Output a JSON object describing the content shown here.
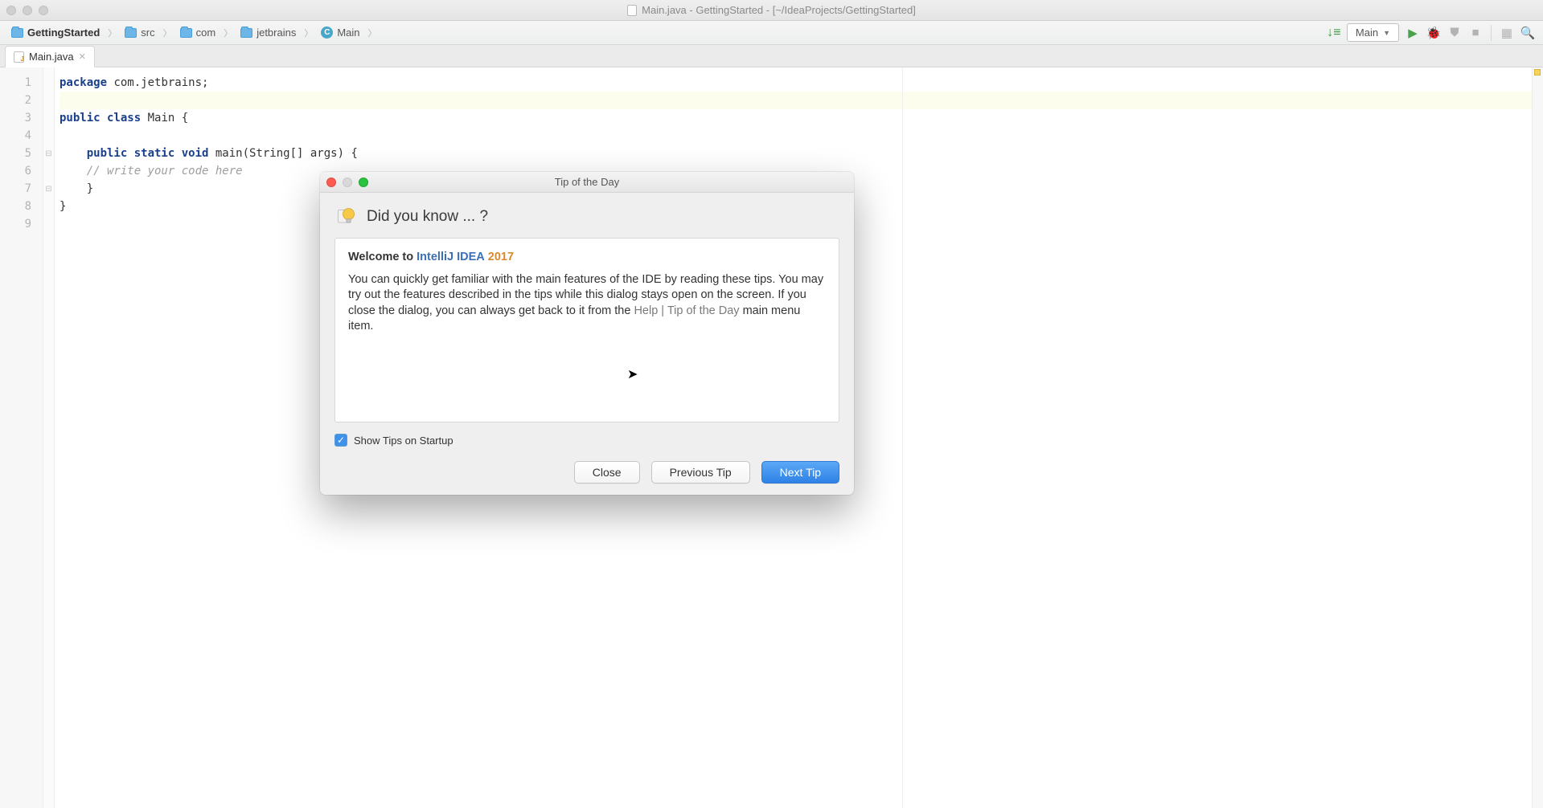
{
  "window": {
    "title": "Main.java - GettingStarted - [~/IdeaProjects/GettingStarted]"
  },
  "breadcrumbs": {
    "project": "GettingStarted",
    "src": "src",
    "com": "com",
    "jetbrains": "jetbrains",
    "klass": "Main"
  },
  "runconfig": {
    "selected": "Main"
  },
  "tab": {
    "name": "Main.java"
  },
  "gutter": {
    "lines": [
      "1",
      "2",
      "3",
      "4",
      "5",
      "6",
      "7",
      "8",
      "9"
    ]
  },
  "code": {
    "l1a": "package",
    "l1b": " com.jetbrains;",
    "l3a": "public class",
    "l3b": " Main {",
    "l5a": "    public static void",
    "l5b": " main(String[] args) {",
    "l6": "    // write your code here",
    "l7": "    }",
    "l8": "}"
  },
  "dialog": {
    "title": "Tip of the Day",
    "heading": "Did you know ... ?",
    "welcome_prefix": "Welcome to ",
    "brand": "IntelliJ IDEA",
    "year": "2017",
    "body1": "You can quickly get familiar with the main features of the IDE by reading these tips. You may try out the features described in the tips while this dialog stays open on the screen. If you close the dialog, you can always get back to it from the ",
    "menu_hint": "Help | Tip of the Day",
    "body2": " main menu item.",
    "show_tips": "Show Tips on Startup",
    "close": "Close",
    "prev": "Previous Tip",
    "next": "Next Tip"
  }
}
